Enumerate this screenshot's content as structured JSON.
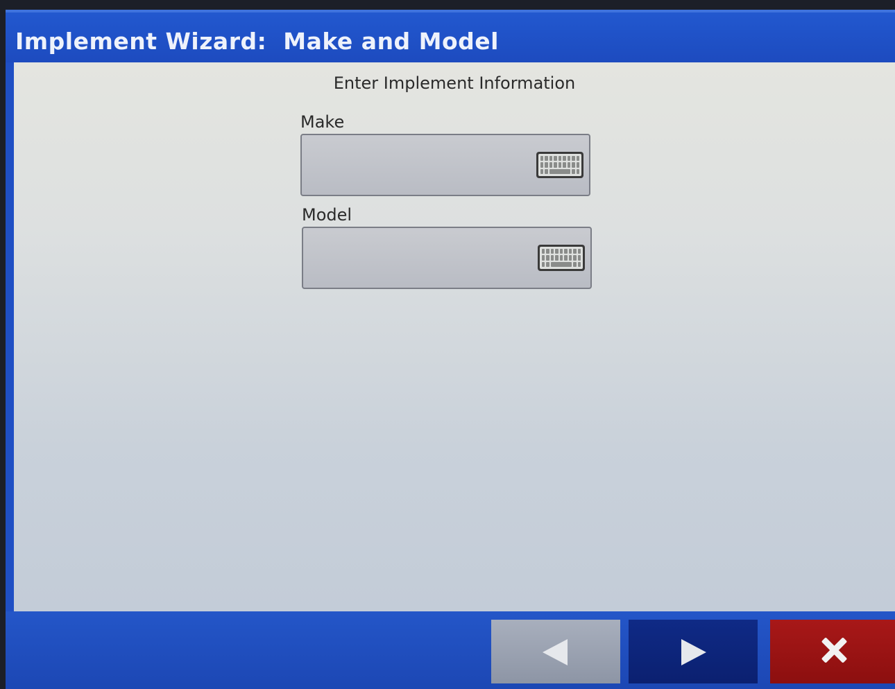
{
  "title_bar": {
    "title": "Implement Wizard:  Make and Model"
  },
  "form": {
    "subtitle": "Enter Implement Information",
    "make": {
      "label": "Make",
      "value": "",
      "icon": "keyboard-icon"
    },
    "model": {
      "label": "Model",
      "value": "",
      "icon": "keyboard-icon"
    }
  },
  "navigation": {
    "back_icon": "arrow-left-icon",
    "next_icon": "arrow-right-icon",
    "cancel_icon": "close-icon"
  },
  "colors": {
    "header_blue": "#1d4bbf",
    "next_button": "#0b2070",
    "cancel_button": "#a81818",
    "back_button_disabled": "#9aa1b0"
  }
}
